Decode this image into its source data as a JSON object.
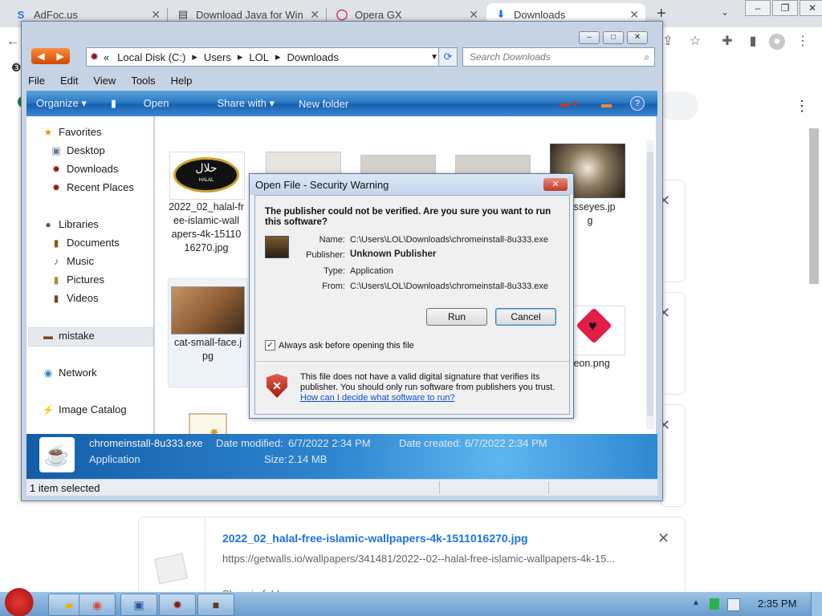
{
  "browser": {
    "tabs": [
      {
        "title": "AdFoc.us",
        "icon": "adfocus-icon"
      },
      {
        "title": "Download Java for Win",
        "icon": "page-icon"
      },
      {
        "title": "Opera GX",
        "icon": "opera-icon"
      },
      {
        "title": "Downloads",
        "icon": "download-icon"
      }
    ],
    "new_tab": "+",
    "menu_dots": "⋮"
  },
  "downloads_page": {
    "item_title": "2022_02_halal-free-islamic-wallpapers-4k-1511016270.jpg",
    "item_url": "https://getwalls.io/wallpapers/341481/2022--02--halal-free-islamic-wallpapers-4k-15...",
    "item_action_partial": "Show in folder",
    "close": "✕"
  },
  "explorer": {
    "address": {
      "prefix": "«",
      "segments": [
        "Local Disk (C:)",
        "Users",
        "LOL",
        "Downloads"
      ]
    },
    "search_placeholder": "Search Downloads",
    "menu": [
      "File",
      "Edit",
      "View",
      "Tools",
      "Help"
    ],
    "commands": [
      "Organize ▾",
      "Open",
      "Share with ▾",
      "New folder"
    ],
    "nav": {
      "favorites": "Favorites",
      "desktop": "Desktop",
      "downloads": "Downloads",
      "recent": "Recent Places",
      "libraries": "Libraries",
      "documents": "Documents",
      "music": "Music",
      "pictures": "Pictures",
      "videos": "Videos",
      "mistake": "mistake",
      "network": "Network",
      "image_catalog": "Image Catalog"
    },
    "files": {
      "f1": "2022_02_halal-free-islamic-wallpapers-4k-1511016270.jpg",
      "f1_lines": [
        "2022_02_halal-fr",
        "ee-islamic-wall",
        "apers-4k-15110",
        "16270.jpg"
      ],
      "f2_lines": [
        "cat-small-face.j",
        "pg"
      ],
      "f3_lines": [
        "rosseyes.jp",
        "g"
      ],
      "f4_lines": [
        "reon.png"
      ],
      "halal_text": "حلال",
      "halal_sub": "HALAL"
    },
    "details": {
      "name": "chromeinstall-8u333.exe",
      "type": "Application",
      "modified_label": "Date modified:",
      "modified": "6/7/2022 2:34 PM",
      "created_label": "Date created:",
      "created": "6/7/2022 2:34 PM",
      "size_label": "Size:",
      "size": "2.14 MB"
    },
    "status": "1 item selected"
  },
  "dialog": {
    "title": "Open File - Security Warning",
    "question": "The publisher could not be verified.  Are you sure you want to run this software?",
    "name_label": "Name:",
    "name": "C:\\Users\\LOL\\Downloads\\chromeinstall-8u333.exe",
    "publisher_label": "Publisher:",
    "publisher": "Unknown Publisher",
    "type_label": "Type:",
    "type": "Application",
    "from_label": "From:",
    "from": "C:\\Users\\LOL\\Downloads\\chromeinstall-8u333.exe",
    "run": "Run",
    "cancel": "Cancel",
    "always_ask": "Always ask before opening this file",
    "warning": "This file does not have a valid digital signature that verifies its publisher.  You should only run software from publishers you trust.",
    "help_link": "How can I decide what software to run?"
  },
  "taskbar": {
    "time": "2:35 PM"
  }
}
